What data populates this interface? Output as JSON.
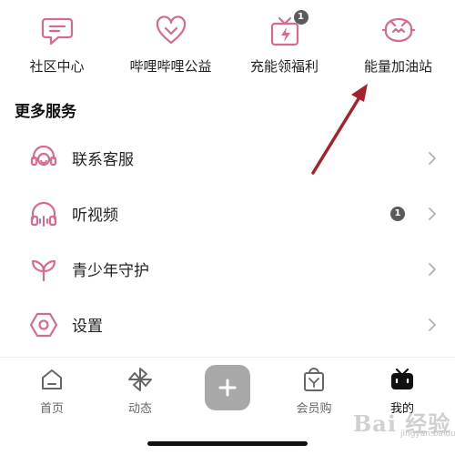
{
  "colors": {
    "icon_pink": "#d86a8f",
    "badge_gray": "#5a5a5a",
    "plus_gray": "#a8a8a8",
    "arrow_red": "#a4232a",
    "chevron_gray": "#b0b0b0"
  },
  "top_grid": {
    "items": [
      {
        "label": "社区中心",
        "icon": "chat-bubble-icon"
      },
      {
        "label": "哔哩哔哩公益",
        "icon": "heart-icon"
      },
      {
        "label": "充能领福利",
        "icon": "gift-lightning-icon",
        "badge": "1"
      },
      {
        "label": "能量加油站",
        "icon": "energy-station-icon"
      }
    ]
  },
  "more_services": {
    "title": "更多服务",
    "items": [
      {
        "label": "联系客服",
        "icon": "headset-icon"
      },
      {
        "label": "听视频",
        "icon": "headphones-icon",
        "badge": "1"
      },
      {
        "label": "青少年守护",
        "icon": "sprout-icon"
      },
      {
        "label": "设置",
        "icon": "settings-hexagon-icon"
      }
    ]
  },
  "tabbar": {
    "tabs": [
      {
        "label": "首页",
        "icon": "home-icon"
      },
      {
        "label": "动态",
        "icon": "pinwheel-icon"
      },
      {
        "label": "会员购",
        "icon": "shopping-bag-icon"
      },
      {
        "label": "我的",
        "icon": "tv-icon",
        "active": true
      }
    ],
    "plus_icon": "plus-icon"
  },
  "watermark": {
    "main": "Bai 经验",
    "sub": "jingyan.baidu.com"
  }
}
